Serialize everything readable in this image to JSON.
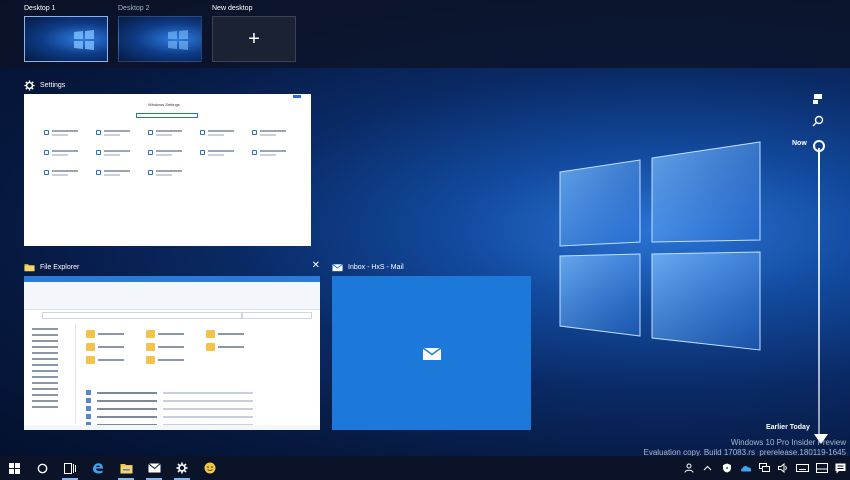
{
  "desktops": [
    {
      "label": "Desktop 1",
      "active": true
    },
    {
      "label": "Desktop 2",
      "active": false
    },
    {
      "label": "New desktop",
      "plus": "+"
    }
  ],
  "windows": [
    {
      "title": "Settings",
      "icon": "gear-icon",
      "inner_title": "Windows Settings"
    },
    {
      "title": "File Explorer",
      "icon": "folder-icon",
      "close": "✕"
    },
    {
      "title": "Inbox - HxS - Mail",
      "icon": "mail-icon"
    }
  ],
  "timeline": {
    "now_label": "Now",
    "earlier_label": "Earlier Today"
  },
  "watermark": {
    "line1": "Windows 10 Pro Insider Preview",
    "line2": "Evaluation copy. Build 17083.rs_prerelease.180119-1645"
  },
  "taskbar": {
    "items": [
      "windows-start-icon",
      "search-circle-icon",
      "task-view-icon",
      "edge-icon",
      "file-explorer-icon",
      "mail-icon",
      "settings-icon",
      "feedback-emoji-icon"
    ],
    "tray": [
      "people-icon",
      "chevron-up-icon",
      "defender-icon",
      "onedrive-icon",
      "network-icon",
      "volume-icon",
      "keyboard-icon",
      "ink-workspace-icon",
      "action-center-icon"
    ]
  },
  "colors": {
    "accent": "#1c78d9",
    "taskbar": "#0b1328"
  }
}
